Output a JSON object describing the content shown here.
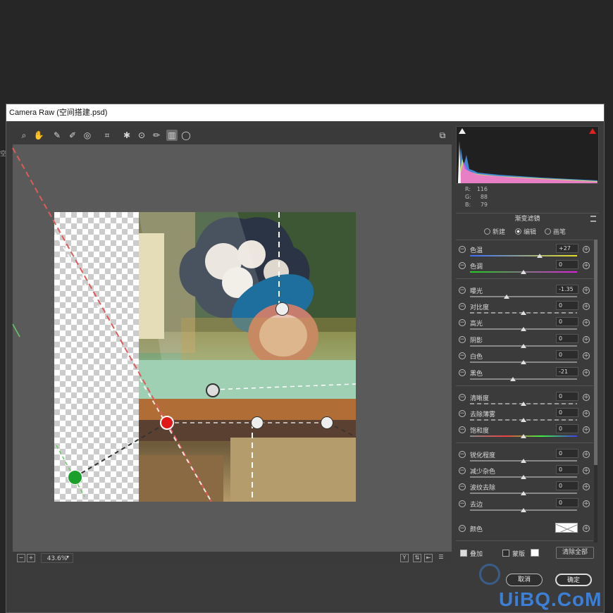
{
  "window": {
    "title": "Camera Raw (空间搭建.psd)"
  },
  "left_edge_label": "空",
  "toolbar": {
    "tools": [
      {
        "name": "zoom-tool-icon",
        "glyph": "⌕"
      },
      {
        "name": "hand-tool-icon",
        "glyph": "✋"
      },
      {
        "name": "white-balance-tool-icon",
        "glyph": "✎"
      },
      {
        "name": "color-sampler-tool-icon",
        "glyph": "✐"
      },
      {
        "name": "targeted-adjustment-icon",
        "glyph": "◎"
      },
      {
        "name": "crop-tool-icon",
        "glyph": "⌗"
      },
      {
        "name": "spot-removal-icon",
        "glyph": "✱"
      },
      {
        "name": "red-eye-icon",
        "glyph": "⊙"
      },
      {
        "name": "adjustment-brush-icon",
        "glyph": "✏"
      },
      {
        "name": "graduated-filter-icon",
        "glyph": "▥"
      },
      {
        "name": "radial-filter-icon",
        "glyph": "◯"
      }
    ],
    "open_prefs_glyph": "⧉"
  },
  "status": {
    "zoom": "43.6%",
    "zoom_minus": "−",
    "zoom_plus": "+"
  },
  "histogram": {
    "r": "116",
    "g": "88",
    "b": "79",
    "r_label": "R:",
    "g_label": "G:",
    "b_label": "B:"
  },
  "panel": {
    "title": "渐变滤镜",
    "modes": [
      "新建",
      "编辑",
      "画笔"
    ],
    "selected_mode": "编辑"
  },
  "sliders": [
    {
      "label": "色温",
      "value": "+27",
      "pos": 0.65
    },
    {
      "label": "色调",
      "value": "0",
      "pos": 0.5
    },
    {
      "label": "曝光",
      "value": "-1.35",
      "pos": 0.34
    },
    {
      "label": "对比度",
      "value": "0",
      "pos": 0.5
    },
    {
      "label": "高光",
      "value": "0",
      "pos": 0.5
    },
    {
      "label": "阴影",
      "value": "0",
      "pos": 0.5
    },
    {
      "label": "白色",
      "value": "0",
      "pos": 0.5
    },
    {
      "label": "黑色",
      "value": "-21",
      "pos": 0.4
    },
    {
      "label": "清晰度",
      "value": "0",
      "pos": 0.5
    },
    {
      "label": "去除薄雾",
      "value": "0",
      "pos": 0.5
    },
    {
      "label": "饱和度",
      "value": "0",
      "pos": 0.5
    },
    {
      "label": "锐化程度",
      "value": "0",
      "pos": 0.5
    },
    {
      "label": "减少杂色",
      "value": "0",
      "pos": 0.5
    },
    {
      "label": "波纹去除",
      "value": "0",
      "pos": 0.5
    },
    {
      "label": "去边",
      "value": "0",
      "pos": 0.5
    }
  ],
  "color_row": {
    "label": "颜色"
  },
  "footer": {
    "overlay_label": "叠加",
    "mask_label": "蒙版",
    "clear_all": "清除全部"
  },
  "buttons": {
    "cancel": "取消",
    "ok": "确定"
  },
  "watermark": "UiBQ.CoM",
  "colors": {
    "accent": "#3b7fd6",
    "green_pin": "#1aa02a",
    "red_pin": "#e01818"
  }
}
